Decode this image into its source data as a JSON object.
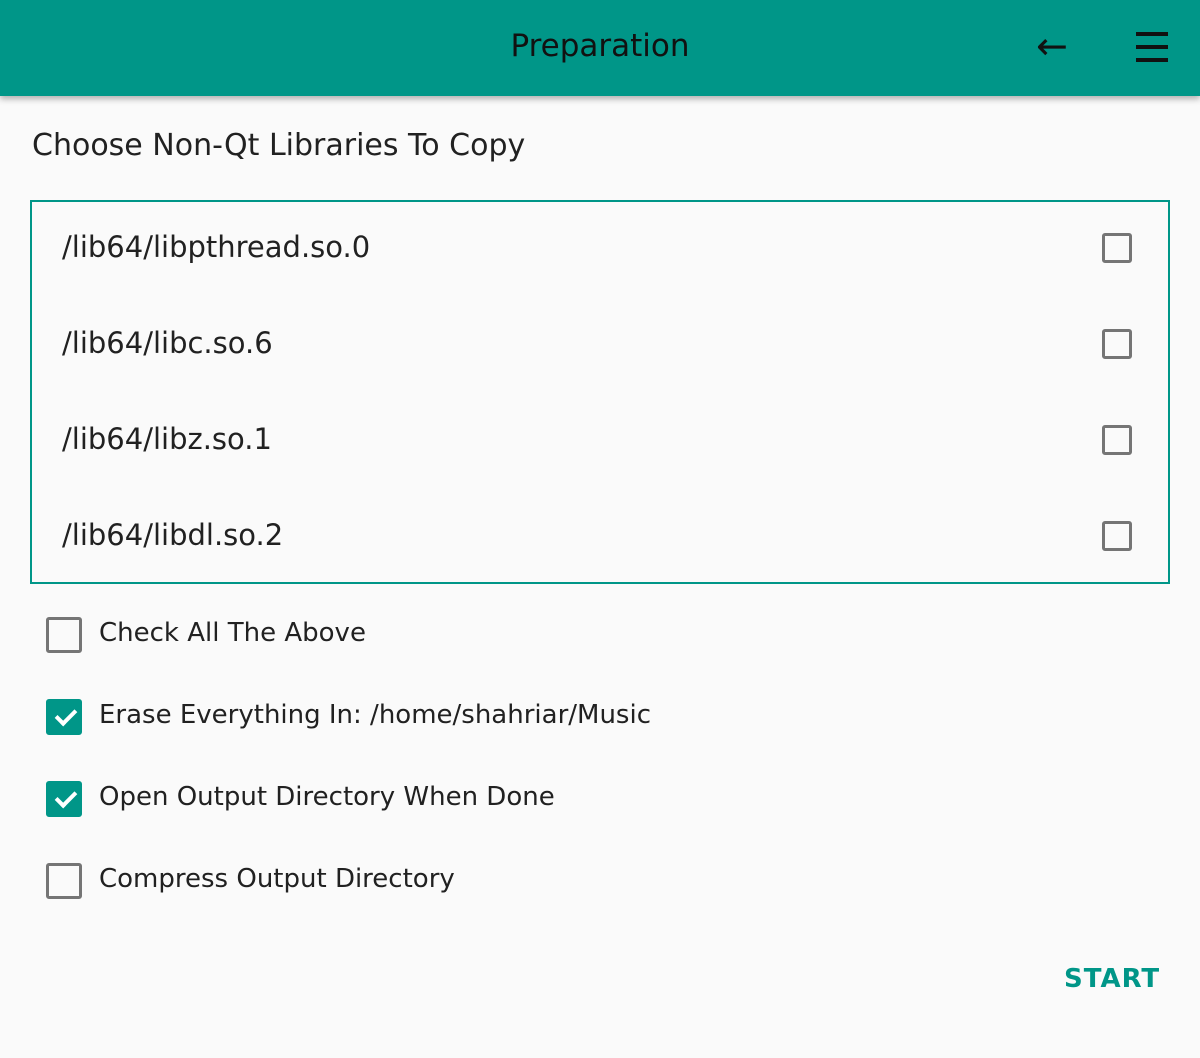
{
  "header": {
    "title": "Preparation",
    "back_icon": "arrow-left-icon",
    "menu_icon": "hamburger-menu-icon",
    "color": "#009688"
  },
  "heading": "Choose Non-Qt Libraries To Copy",
  "libraries": [
    {
      "label": "/lib64/libpthread.so.0",
      "checked": false
    },
    {
      "label": "/lib64/libc.so.6",
      "checked": false
    },
    {
      "label": "/lib64/libz.so.1",
      "checked": false
    },
    {
      "label": "/lib64/libdl.so.2",
      "checked": false
    }
  ],
  "options": [
    {
      "label": "Check All The Above",
      "checked": false
    },
    {
      "label": "Erase Everything In: /home/shahriar/Music",
      "checked": true
    },
    {
      "label": "Open Output Directory When Done",
      "checked": true
    },
    {
      "label": "Compress Output Directory",
      "checked": false
    }
  ],
  "start_label": "START"
}
